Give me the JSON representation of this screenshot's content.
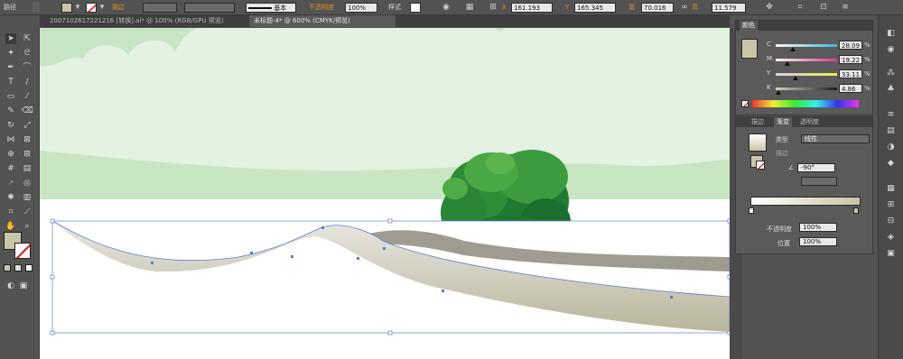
{
  "control_bar": {
    "object_type": "路径",
    "stroke_label": "描边",
    "stroke_style": "基本",
    "opacity_label": "不透明度",
    "opacity_value": "100%",
    "style_label": "样式",
    "x_label": "X",
    "x_value": "161.193",
    "y_label": "Y",
    "y_value": "165.345",
    "w_label": "宽",
    "w_value": "70.016",
    "h_label": "高",
    "h_value": "11.579",
    "fill_color": "#c8c6a4",
    "accent_orange": "#e08a2c"
  },
  "tabs": [
    {
      "label": "2007102617221216 [转换].ai* @ 100% (RGB/GPU 预览)",
      "active": false
    },
    {
      "label": "未标题-4* @ 600% (CMYK/预览)",
      "active": true
    }
  ],
  "color_panel": {
    "tab": "颜色",
    "channels": [
      {
        "label": "C",
        "value": "28.09",
        "unit": "%",
        "fraction": 0.28,
        "gradient": "linear-gradient(90deg,#fbf6ee,#3fb6e6)"
      },
      {
        "label": "M",
        "value": "19.22",
        "unit": "%",
        "fraction": 0.19,
        "gradient": "linear-gradient(90deg,#f7f5e8,#e2368c)"
      },
      {
        "label": "Y",
        "value": "33.11",
        "unit": "%",
        "fraction": 0.33,
        "gradient": "linear-gradient(90deg,#d6d0e6,#efe84a)"
      },
      {
        "label": "K",
        "value": "4.86",
        "unit": "%",
        "fraction": 0.05,
        "gradient": "linear-gradient(90deg,#d2d0ba,#1a1a1a)"
      }
    ],
    "swatch_color": "#c8c6a4"
  },
  "gradient_panel": {
    "tabs": [
      "描边",
      "渐变",
      "透明度"
    ],
    "active_tab": "渐变",
    "type_label": "类型",
    "type_value": "线性",
    "stroke_label": "描边",
    "angle_value": "-90°",
    "opacity_label": "不透明度",
    "opacity_value": "100%",
    "location_label": "位置",
    "location_value": "100%",
    "stop_start": "#ffffff",
    "stop_end": "#c8c6a4"
  },
  "artwork": {
    "sky_color": "#e4f2e2",
    "cloud_color": "#c8e5c5",
    "hill_color": "#c9e6c3",
    "bush_dark": "#1f7a33",
    "bush_light": "#48a944",
    "road_top": "#e8e7e1",
    "road_bottom": "#b8b59a",
    "road_edge": "#9e9c90",
    "selection_color": "#5b7cd6"
  }
}
